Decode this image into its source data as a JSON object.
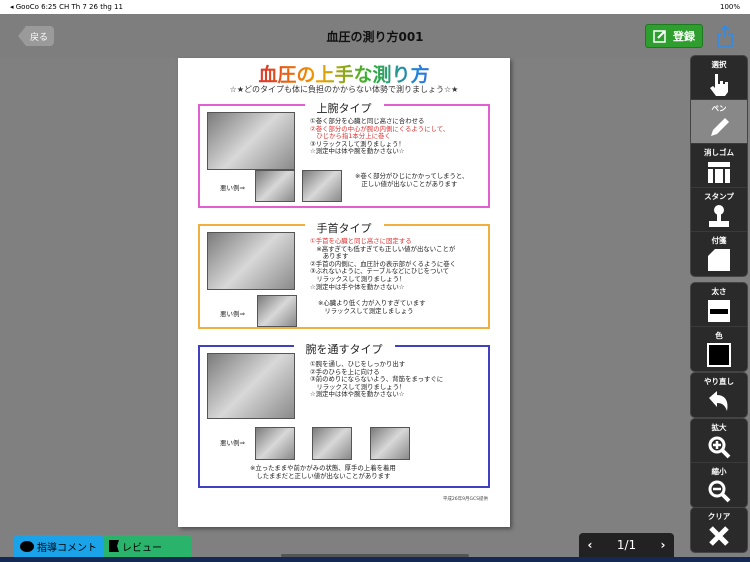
{
  "status": {
    "left": "◂ GooCo  6:25 CH  Th 7 26 thg 11",
    "right": "100%"
  },
  "nav": {
    "back": "戻る",
    "title": "血圧の測り方001",
    "register": "登録"
  },
  "doc": {
    "title": "血圧の上手な測り方",
    "subtitle": "☆★どのタイプも体に負担のかからない体勢で測りましょう☆★",
    "sections": [
      {
        "heading": "上腕タイプ",
        "lines": [
          "①巻く部分を心臓と同じ高さに合わせる",
          "②巻く部分の中心が腕の内側にくるようにして、",
          "　ひじから指1本分上に巻く",
          "③リラックスして測りましょう！",
          "☆測定中は体や腕を動かさない☆"
        ],
        "bad": "悪い例⇒",
        "note": "※巻く部分がひじにかかってしまうと、\n　正しい値が出ないことがあります"
      },
      {
        "heading": "手首タイプ",
        "lines": [
          "①手首を心臓と同じ高さに固定する",
          "　※高すぎても低すぎても正しい値が出ないことが",
          "　　あります",
          "②手首の内側に、血圧計の表示部がくるように巻く",
          "③ぶれないように、テーブルなどにひじをついて",
          "　リラックスして測りましょう！",
          "☆測定中は手や体を動かさない☆"
        ],
        "bad": "悪い例⇒",
        "note": "※心臓より低く力が入りすぎています\n　リラックスして測定しましょう"
      },
      {
        "heading": "腕を通すタイプ",
        "lines": [
          "①腕を通し、ひじをしっかり出す",
          "②手のひらを上に向ける",
          "③前のめりにならないよう、背筋をまっすぐに",
          "　リラックスして測りましょう！",
          "☆測定中は体や腕を動かさない☆"
        ],
        "bad": "悪い例⇒",
        "note": "※立ったままや前かがみの状態、厚手の上着を着用\n　したままだと正しい値が出ないことがあります"
      }
    ],
    "footer": "平成26年9月GCS提供"
  },
  "tools": [
    "選択",
    "ペン",
    "消しゴム",
    "スタンプ",
    "付箋",
    "太さ",
    "色",
    "やり直し",
    "拡大",
    "縮小",
    "クリア"
  ],
  "tabs": {
    "comment": "指導コメント",
    "review": "レビュー"
  },
  "pager": {
    "label": "1/1"
  },
  "colors": {
    "upper": "#e060d0",
    "wrist": "#f0b040",
    "through": "#4040c0",
    "register": "#2e9e2e",
    "comment_tab": "#1aa3e8",
    "review_tab": "#2ab36a"
  }
}
